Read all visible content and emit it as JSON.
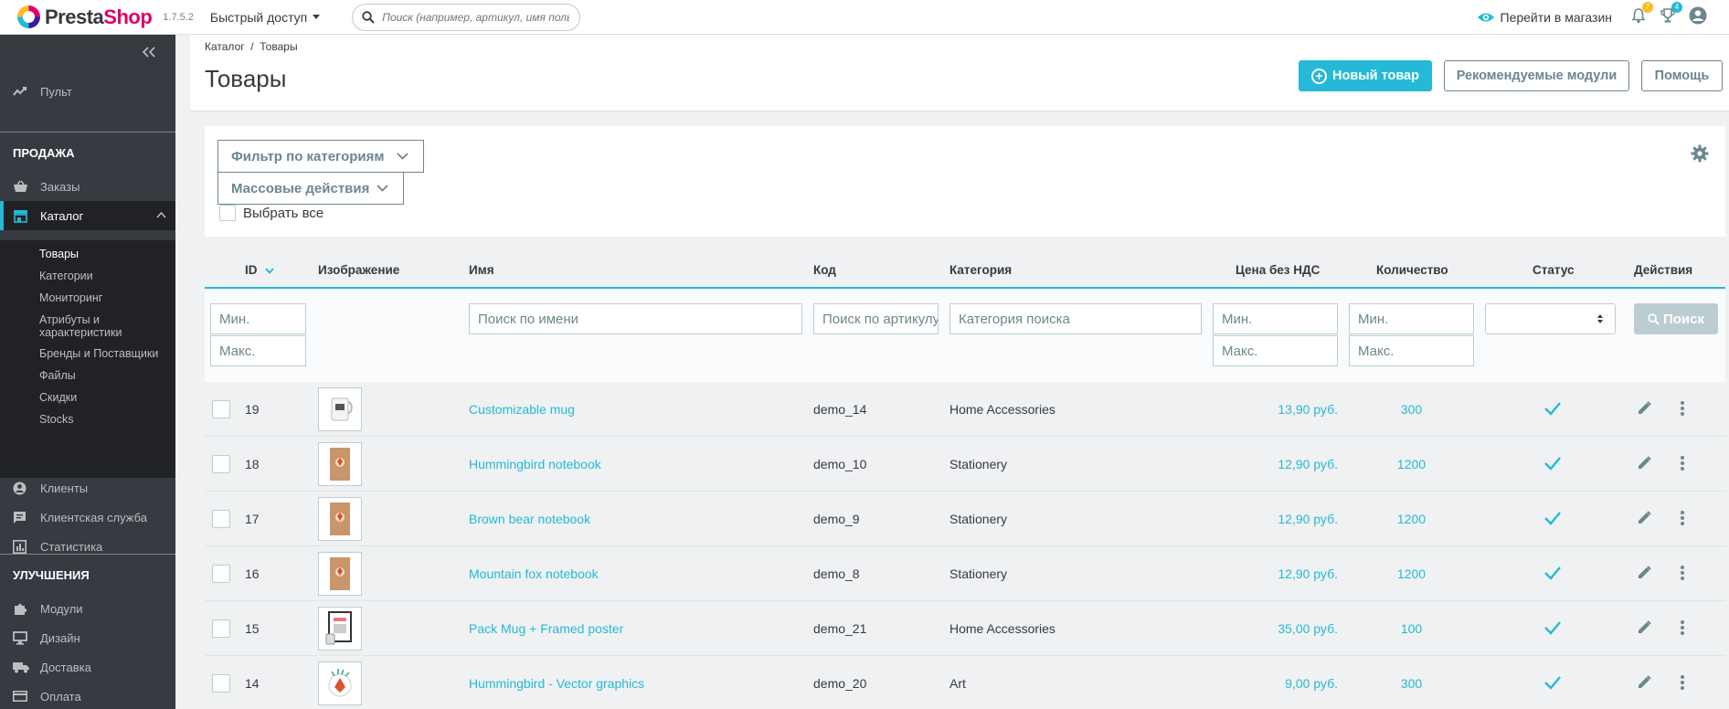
{
  "header": {
    "logo_prefix": "Presta",
    "logo_suffix": "Shop",
    "version": "1.7.5.2",
    "quick_access": "Быстрый доступ",
    "search_placeholder": "Поиск (например, артикул, имя поль:",
    "view_shop": "Перейти в магазин",
    "notifications_orders": "7",
    "notifications_customers": "4"
  },
  "sidebar": {
    "dashboard": "Пульт",
    "section_sell": "ПРОДАЖА",
    "orders": "Заказы",
    "catalog": "Каталог",
    "catalog_sub": [
      "Товары",
      "Категории",
      "Мониторинг",
      "Атрибуты и характеристики",
      "Бренды и Поставщики",
      "Файлы",
      "Скидки",
      "Stocks"
    ],
    "customers": "Клиенты",
    "customer_service": "Клиентская служба",
    "stats": "Статистика",
    "section_improve": "УЛУЧШЕНИЯ",
    "modules": "Модули",
    "design": "Дизайн",
    "shipping": "Доставка",
    "payment": "Оплата"
  },
  "page": {
    "breadcrumb": "Каталог  /  Товары",
    "title": "Товары",
    "new_product": "Новый товар",
    "recommended_modules": "Рекомендуемые модули",
    "help": "Помощь"
  },
  "filters": {
    "category_filter": "Фильтр по категориям",
    "bulk_actions": "Массовые действия",
    "select_all": "Выбрать все"
  },
  "table": {
    "columns": [
      "ID",
      "Изображение",
      "Имя",
      "Код",
      "Категория",
      "Цена без НДС",
      "Количество",
      "Статус",
      "Действия"
    ],
    "filter_placeholders": {
      "min": "Мин.",
      "max": "Макс.",
      "name": "Поиск по имени",
      "reference": "Поиск по артикулу",
      "category": "Категория поиска"
    },
    "search_button": "Поиск",
    "rows": [
      {
        "id": "19",
        "name": "Customizable mug",
        "ref": "demo_14",
        "category": "Home Accessories",
        "price": "13,90 руб.",
        "qty": "300",
        "image": "mug"
      },
      {
        "id": "18",
        "name": "Hummingbird notebook",
        "ref": "demo_10",
        "category": "Stationery",
        "price": "12,90 руб.",
        "qty": "1200",
        "image": "notebook"
      },
      {
        "id": "17",
        "name": "Brown bear notebook",
        "ref": "demo_9",
        "category": "Stationery",
        "price": "12,90 руб.",
        "qty": "1200",
        "image": "notebook"
      },
      {
        "id": "16",
        "name": "Mountain fox notebook",
        "ref": "demo_8",
        "category": "Stationery",
        "price": "12,90 руб.",
        "qty": "1200",
        "image": "notebook"
      },
      {
        "id": "15",
        "name": "Pack Mug + Framed poster",
        "ref": "demo_21",
        "category": "Home Accessories",
        "price": "35,00 руб.",
        "qty": "100",
        "image": "poster"
      },
      {
        "id": "14",
        "name": "Hummingbird - Vector graphics",
        "ref": "demo_20",
        "category": "Art",
        "price": "9,00 руб.",
        "qty": "300",
        "image": "vector"
      }
    ]
  },
  "colors": {
    "accent": "#25b9d7",
    "sidebar_bg": "#363a41",
    "sidebar_active_bg": "#202226",
    "brand_pink": "#df0067"
  }
}
